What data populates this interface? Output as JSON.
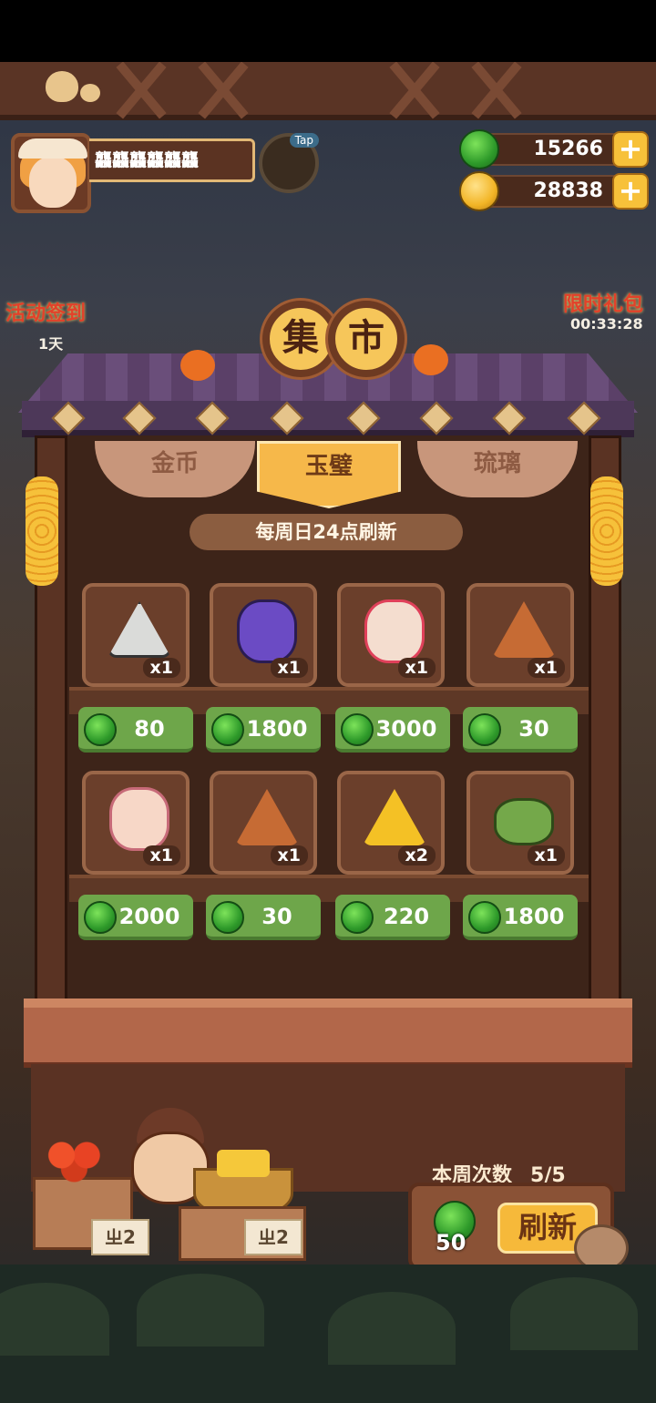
{
  "player": {
    "name": "龘龘龘龘龘龘"
  },
  "hud": {
    "tap_label": "Tap"
  },
  "currencies": [
    {
      "name": "jade",
      "value": "15266"
    },
    {
      "name": "coin",
      "value": "28838"
    }
  ],
  "side_events": {
    "activity_signin": "活动签到",
    "activity_days": "1天",
    "limited_gift": "限时礼包",
    "limited_timer": "00:33:28"
  },
  "market": {
    "title_chars": [
      "集",
      "市"
    ],
    "tabs": [
      {
        "label": "金币",
        "active": false
      },
      {
        "label": "玉璧",
        "active": true
      },
      {
        "label": "琉璃",
        "active": false
      }
    ],
    "refresh_note": "每周日24点刷新",
    "items": [
      {
        "icon": "silver-triangle-token-icon",
        "qty": "x1",
        "price": "80"
      },
      {
        "icon": "purple-cat-statue-icon",
        "qty": "x1",
        "price": "1800"
      },
      {
        "icon": "white-hair-character-icon",
        "qty": "x1",
        "price": "3000"
      },
      {
        "icon": "bronze-triangle-token-icon",
        "qty": "x1",
        "price": "30"
      },
      {
        "icon": "pink-hair-character-icon",
        "qty": "x1",
        "price": "2000"
      },
      {
        "icon": "bronze-triangle-token-icon",
        "qty": "x1",
        "price": "30"
      },
      {
        "icon": "gold-triangle-token-icon",
        "qty": "x2",
        "price": "220"
      },
      {
        "icon": "green-jade-pendant-icon",
        "qty": "x1",
        "price": "1800"
      }
    ],
    "weekly_label": "本周次数",
    "weekly_count": "5/5",
    "refresh_cost": "50",
    "refresh_button": "刷新"
  },
  "stall_cards": [
    "ㄓ2",
    "ㄓ2"
  ],
  "colors": {
    "price_bg": "#6ea64a",
    "tab_active": "#f6b84a",
    "jade": "#2e9a2a"
  }
}
